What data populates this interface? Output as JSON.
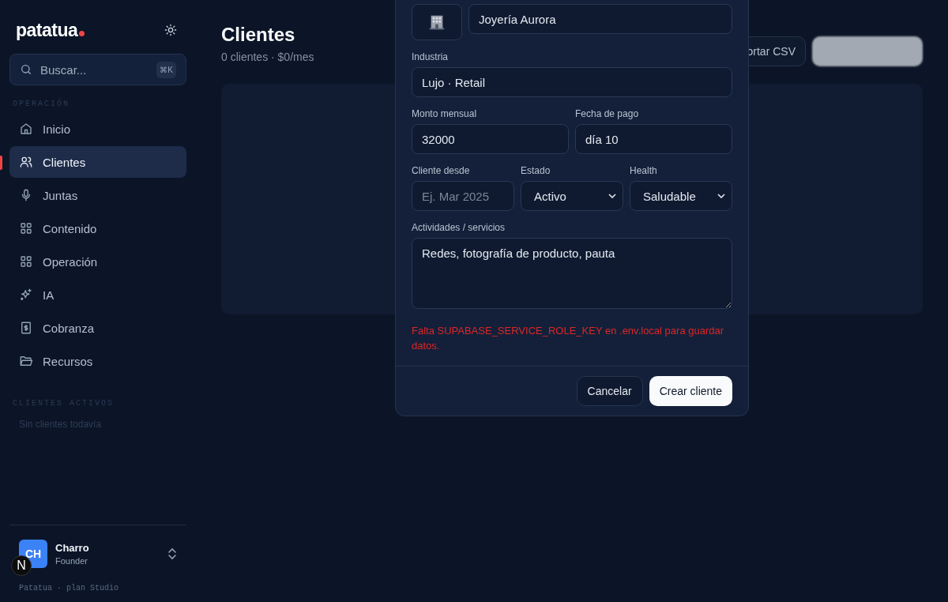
{
  "sidebar": {
    "logo": "patatua",
    "search": {
      "placeholder": "Buscar...",
      "shortcut": "⌘K"
    },
    "sections": [
      {
        "label": "OPERACIÓN",
        "items": [
          {
            "label": "Inicio",
            "selected": false
          },
          {
            "label": "Clientes",
            "selected": true
          },
          {
            "label": "Juntas",
            "selected": false
          },
          {
            "label": "Contenido",
            "selected": false
          },
          {
            "label": "Operación",
            "selected": false
          },
          {
            "label": "IA",
            "selected": false
          },
          {
            "label": "Cobranza",
            "selected": false
          },
          {
            "label": "Recursos",
            "selected": false
          }
        ]
      }
    ],
    "active_clients": {
      "label": "CLIENTES ACTIVOS",
      "empty": "Sin clientes todavía"
    },
    "user": {
      "initials": "CH",
      "name": "Charro",
      "role": "Founder"
    },
    "plan": "Patatua · plan Studio",
    "dev_badge": "N"
  },
  "page": {
    "title": "Clientes",
    "subtitle": "0 clientes · $0/mes",
    "import_button": "ortar CSV"
  },
  "modal": {
    "name": {
      "value": "Joyería Aurora"
    },
    "fields": [
      {
        "kind": "input",
        "label": "Industria",
        "value": "Lujo · Retail"
      },
      {
        "kind": "input",
        "label": "Monto mensual",
        "value": "32000"
      },
      {
        "kind": "input",
        "label": "Fecha de pago",
        "value": "día 10"
      },
      {
        "kind": "input",
        "label": "Cliente desde",
        "placeholder": "Ej. Mar 2025"
      },
      {
        "kind": "select",
        "label": "Estado",
        "value": "Activo"
      },
      {
        "kind": "select",
        "label": "Health",
        "value": "Saludable"
      },
      {
        "kind": "textarea",
        "label": "Actividades / servicios",
        "value": "Redes, fotografía de producto, pauta"
      }
    ],
    "error": "Falta SUPABASE_SERVICE_ROLE_KEY en .env.local para guardar datos.",
    "buttons": [
      {
        "kind": "secondary",
        "label": "Cancelar"
      },
      {
        "kind": "primary",
        "label": "Crear cliente"
      }
    ]
  }
}
